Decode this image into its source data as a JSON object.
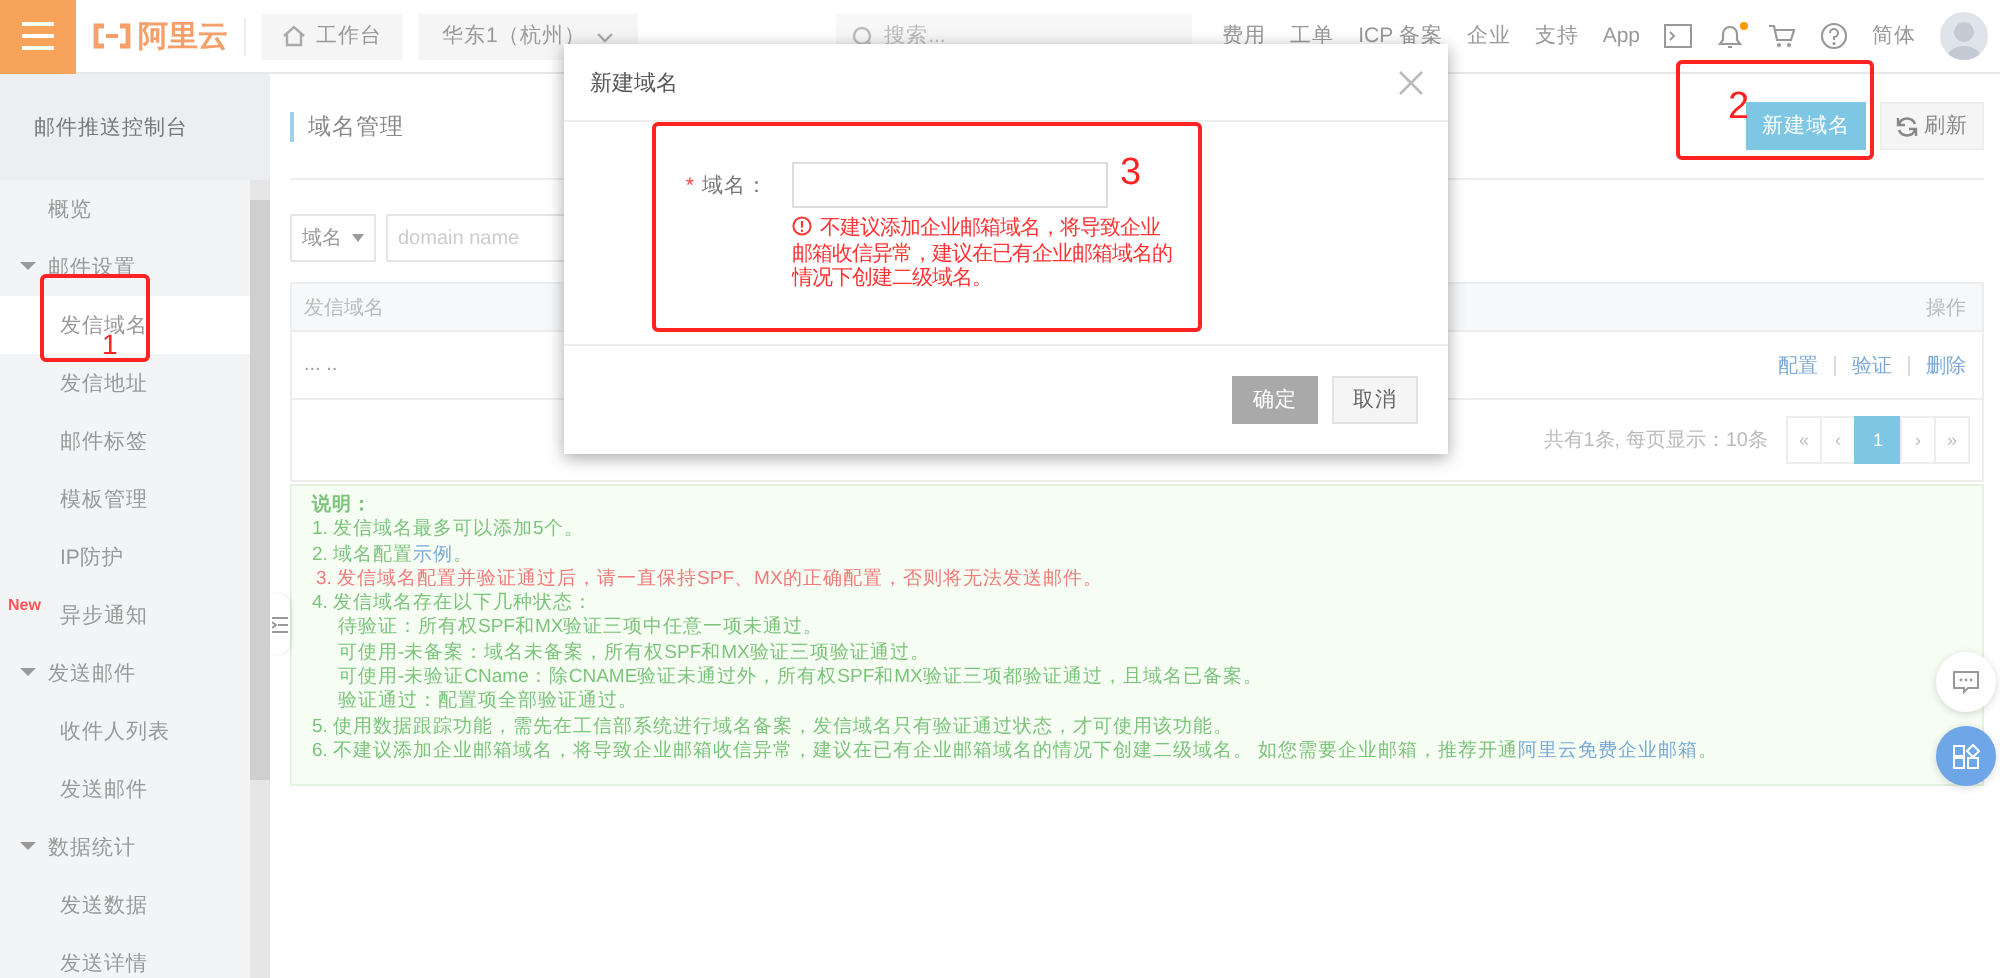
{
  "top_bar": {
    "logo": "阿里云",
    "workbench": "工作台",
    "region": "华东1（杭州）",
    "search": {
      "placeholder": "搜索..."
    },
    "links": [
      "费用",
      "工单",
      "ICP 备案",
      "企业",
      "支持",
      "App"
    ],
    "notification_dot": true,
    "language": "简体"
  },
  "sidebar": {
    "title": "邮件推送控制台",
    "items": [
      {
        "kind": "link",
        "label": "概览",
        "selected": false
      },
      {
        "kind": "group",
        "label": "邮件设置",
        "expanded": true,
        "children": [
          {
            "label": "发信域名",
            "selected": true
          },
          {
            "label": "发信地址",
            "selected": false
          },
          {
            "label": "邮件标签",
            "selected": false
          },
          {
            "label": "模板管理",
            "selected": false
          },
          {
            "label": "IP防护",
            "selected": false
          },
          {
            "label": "异步通知",
            "selected": false,
            "badge": "New"
          }
        ]
      },
      {
        "kind": "group",
        "label": "发送邮件",
        "expanded": true,
        "children": [
          {
            "label": "收件人列表",
            "selected": false
          },
          {
            "label": "发送邮件",
            "selected": false
          }
        ]
      },
      {
        "kind": "group",
        "label": "数据统计",
        "expanded": true,
        "children": [
          {
            "label": "发送数据",
            "selected": false
          },
          {
            "label": "发送详情",
            "selected": false
          }
        ]
      }
    ]
  },
  "page": {
    "title": "域名管理",
    "create_button": "新建域名",
    "refresh_button": "刷新",
    "filter": {
      "field": "域名",
      "placeholder": "domain name"
    },
    "table": {
      "columns": [
        "发信域名",
        "操作"
      ],
      "rows": [
        {
          "domain": "... ..",
          "actions": [
            "配置",
            "验证",
            "删除"
          ]
        }
      ]
    },
    "pagination": {
      "summary": "共有1条, 每页显示：10条",
      "pages": [
        {
          "label": "«",
          "selected": false
        },
        {
          "label": "‹",
          "selected": false
        },
        {
          "label": "1",
          "selected": true
        },
        {
          "label": "›",
          "selected": false
        },
        {
          "label": "»",
          "selected": false
        }
      ]
    },
    "notice": {
      "title": "说明：",
      "items": [
        {
          "kind": "item",
          "text": "1. 发信域名最多可以添加5个。"
        },
        {
          "kind": "item",
          "text": "2. 域名配置",
          "link": "示例",
          "tail": "。"
        },
        {
          "kind": "warning",
          "text": "3. 发信域名配置并验证通过后，请一直保持SPF、MX的正确配置，否则将无法发送邮件。"
        },
        {
          "kind": "item",
          "text": "4. 发信域名存在以下几种状态："
        },
        {
          "kind": "sub",
          "text": "待验证：所有权SPF和MX验证三项中任意一项未通过。"
        },
        {
          "kind": "sub",
          "text": "可使用-未备案：域名未备案，所有权SPF和MX验证三项验证通过。"
        },
        {
          "kind": "sub",
          "text": "可使用-未验证CName：除CNAME验证未通过外，所有权SPF和MX验证三项都验证通过，且域名已备案。"
        },
        {
          "kind": "sub",
          "text": "验证通过：配置项全部验证通过。"
        },
        {
          "kind": "item",
          "text": "5. 使用数据跟踪功能，需先在工信部系统进行域名备案，发信域名只有验证通过状态，才可使用该功能。"
        },
        {
          "kind": "item",
          "text": "6. 不建议添加企业邮箱域名，将导致企业邮箱收信异常，建议在已有企业邮箱域名的情况下创建二级域名。 如您需要企业邮箱，推荐开通",
          "link": "阿里云免费企业邮箱",
          "tail": "。"
        }
      ]
    }
  },
  "dialog": {
    "title": "新建域名",
    "field": {
      "label": "域名：",
      "required_mark": "*"
    },
    "warning": "不建议添加企业邮箱域名，将导致企业邮箱收信异常，建议在已有企业邮箱域名的情况下创建二级域名。",
    "buttons": [
      {
        "label": "确定",
        "kind": "primary",
        "disabled": true
      },
      {
        "label": "取消",
        "kind": "default",
        "disabled": false
      }
    ]
  },
  "annotations": [
    {
      "label": "1"
    },
    {
      "label": "2"
    },
    {
      "label": "3"
    }
  ]
}
